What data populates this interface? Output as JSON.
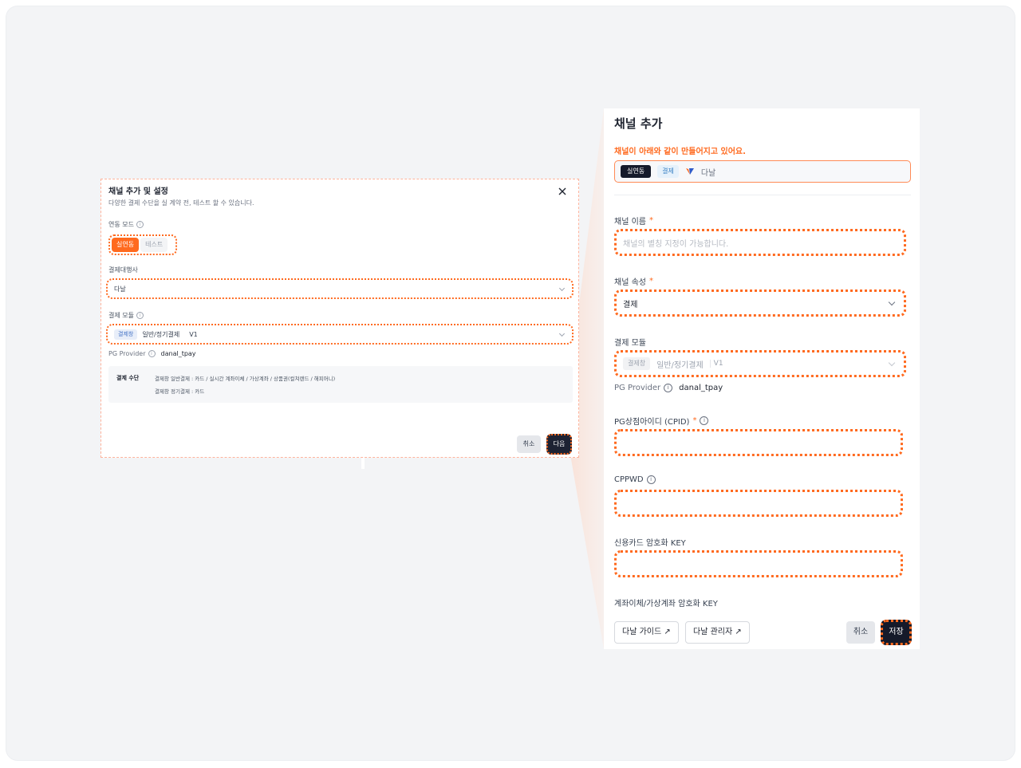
{
  "left_dialog": {
    "title": "채널 추가 및 설정",
    "subtitle": "다양한 결제 수단을 실 계약 전, 테스트 할 수 있습니다.",
    "mode_label": "연동 모드",
    "mode_options": [
      "실연동",
      "테스트"
    ],
    "pg_label": "결제대행사",
    "pg_value": "다날",
    "module_label": "결제 모듈",
    "module_tag": "결제창",
    "module_value": "일반/정기결제",
    "module_version": "V1",
    "pg_provider_label": "PG Provider",
    "pg_provider_value": "danal_tpay",
    "means_label": "결제 수단",
    "means_line1": "결제창 일반결제 : 카드 / 실시간 계좌이체 / 가상계좌 / 상품권(컬쳐랜드 / 해피머니)",
    "means_line2": "결제창 정기결제 : 카드",
    "cancel_label": "취소",
    "next_label": "다음"
  },
  "right_panel": {
    "title": "채널 추가",
    "notice": "채널이 아래와 같이 만들어지고 있어요.",
    "preview": {
      "mode": "실연동",
      "type": "결제",
      "pg": "다날"
    },
    "channel_name_label": "채널 이름",
    "required_mark": "*",
    "channel_name_placeholder": "채널의 별칭 지정이 가능합니다.",
    "channel_attr_label": "채널 속성",
    "channel_attr_value": "결제",
    "module_label": "결제 모듈",
    "module_tag": "결제창",
    "module_value": "일반/정기결제",
    "module_version": "V1",
    "pg_provider_label": "PG Provider",
    "pg_provider_value": "danal_tpay",
    "cpid_label": "PG상점아이디 (CPID)",
    "cppwd_label": "CPPWD",
    "card_key_label": "신용카드 암호화 KEY",
    "account_key_label": "계좌이체/가상계좌 암호화 KEY",
    "guide_button": "다날 가이드 ↗",
    "admin_button": "다날 관리자 ↗",
    "cancel_label": "취소",
    "save_label": "저장"
  },
  "colors": {
    "accent": "#ff6a1f",
    "dark_button": "#151a2a",
    "background": "#f3f4f6"
  }
}
